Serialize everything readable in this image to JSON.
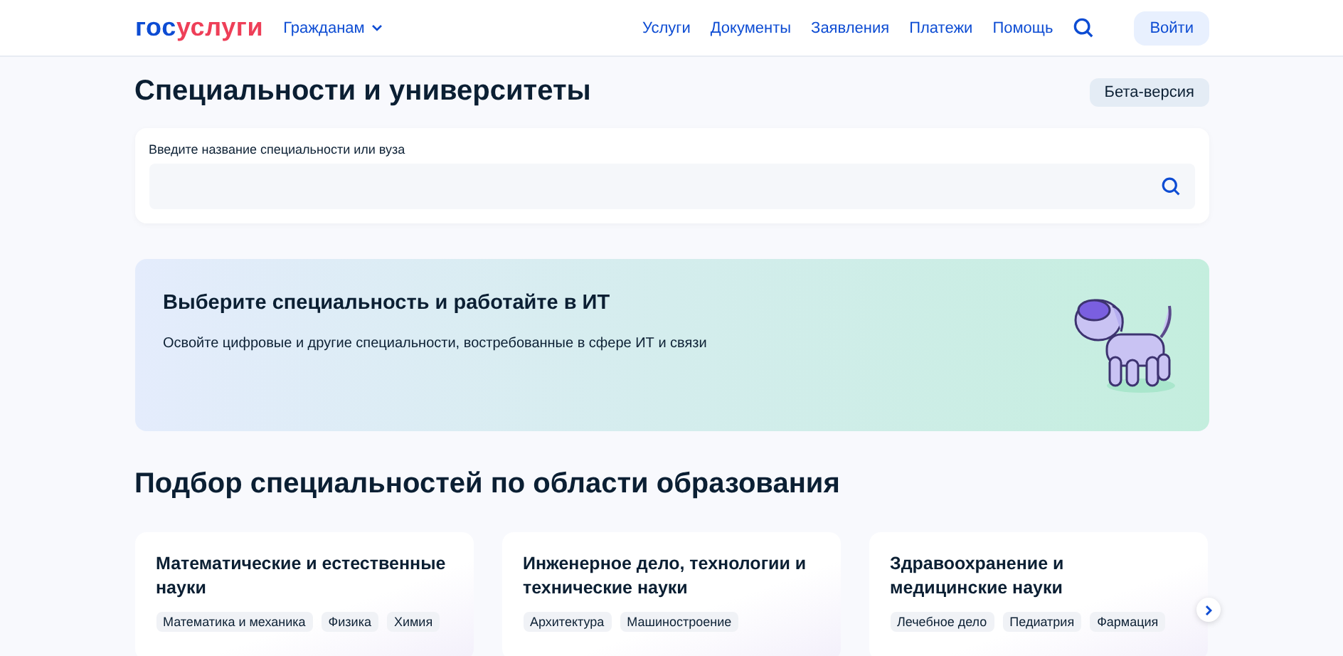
{
  "header": {
    "logo": [
      "гос",
      "услуги"
    ],
    "audience": "Гражданам",
    "nav": [
      "Услуги",
      "Документы",
      "Заявления",
      "Платежи",
      "Помощь"
    ],
    "login": "Войти"
  },
  "page_title": "Специальности и университеты",
  "badge": "Бета-версия",
  "search": {
    "label": "Введите название специальности или вуза"
  },
  "banner": {
    "title": "Выберите специальность и работайте в ИТ",
    "text": "Освойте цифровые и другие специальности, востребованные в сфере ИТ и связи"
  },
  "section_title": "Подбор специальностей по области образования",
  "cards": [
    {
      "title": "Математические и естественные науки",
      "tags": [
        "Математика и механика",
        "Физика",
        "Химия"
      ]
    },
    {
      "title": "Инженерное дело, технологии и технические науки",
      "tags": [
        "Архитектура",
        "Машиностроение"
      ]
    },
    {
      "title": "Здравоохранение и медицинские науки",
      "tags": [
        "Лечебное дело",
        "Педиатрия",
        "Фармация"
      ]
    }
  ]
}
